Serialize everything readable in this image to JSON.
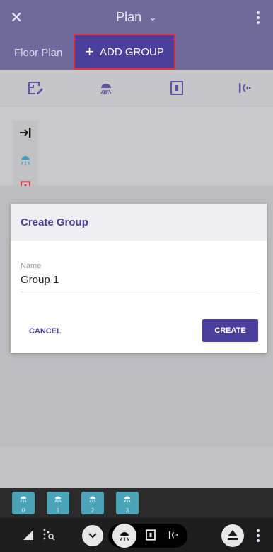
{
  "appbar": {
    "close_icon": "close-icon",
    "title": "Plan",
    "chevron": "chevron-down-icon",
    "more_icon": "more-vertical-icon"
  },
  "subbar": {
    "floor_plan_label": "Floor Plan",
    "add_group_label": "ADD GROUP"
  },
  "toolrow": {
    "icons": [
      "floor-plan-edit-icon",
      "ceiling-light-icon",
      "switch-icon",
      "sensor-icon"
    ]
  },
  "strip": {
    "icons": [
      "collapse-arrow-icon",
      "ceiling-light-icon",
      "switch-icon"
    ]
  },
  "dialog": {
    "title": "Create Group",
    "name_label": "Name",
    "name_value": "Group 1",
    "cancel_label": "CANCEL",
    "create_label": "CREATE"
  },
  "chips": [
    {
      "label": "0"
    },
    {
      "label": "1"
    },
    {
      "label": "2"
    },
    {
      "label": "3"
    }
  ],
  "bottombar": {
    "icons": [
      "signal-icon",
      "scan-icon",
      "chevron-down-icon",
      "ceiling-light-icon",
      "switch-icon",
      "sensor-icon",
      "eject-icon",
      "more-vertical-icon"
    ]
  },
  "colors": {
    "primary": "#4b3f9b",
    "appbar": "#6f6a9c",
    "highlight": "#e0303a",
    "chip": "#4aa3b6"
  }
}
